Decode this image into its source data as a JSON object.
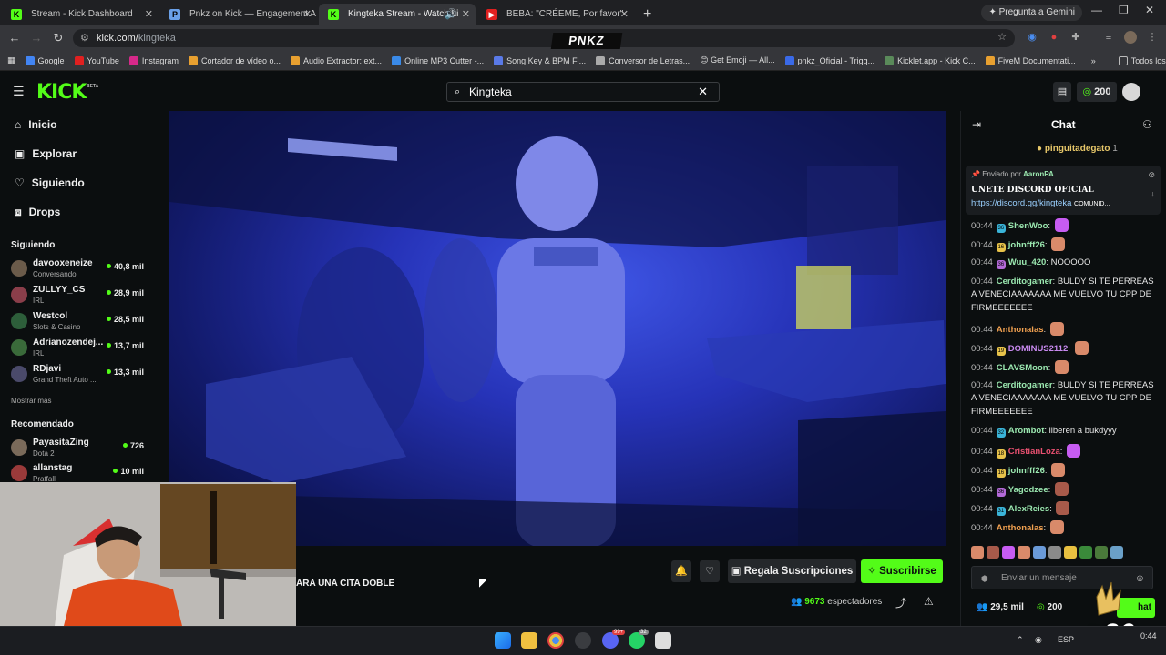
{
  "browser": {
    "tabs": [
      {
        "title": "Stream - Kick Dashboard",
        "icon": "kick-icon"
      },
      {
        "title": "Pnkz on Kick — Engagement A",
        "icon": "page-icon"
      },
      {
        "title": "Kingteka Stream - Watch Li",
        "icon": "kick-icon",
        "active": true
      },
      {
        "title": "BEBA: \"CRÉEME, Por favor\"",
        "icon": "youtube-icon"
      }
    ],
    "gemini_label": "Pregunta a Gemini",
    "url_host": "kick.com/",
    "url_path": "kingteka",
    "ext_badge": "PNKZ",
    "bookmarks": [
      "Google",
      "YouTube",
      "Instagram",
      "Cortador de vídeo o...",
      "Audio Extractor: ext...",
      "Online MP3 Cutter -...",
      "Song Key & BPM Fi...",
      "Conversor de Letras...",
      "😊 Get Emoji — All...",
      "pnkz_Oficial - Trigg...",
      "Kicklet.app - Kick C...",
      "FiveM Documentati..."
    ],
    "bookmarks_more": "»",
    "all_bookmarks": "Todos los marcadores"
  },
  "header": {
    "logo": "KICK",
    "beta": "BETA",
    "search_value": "Kingteka",
    "points": "200"
  },
  "sidebar": {
    "nav": [
      {
        "label": "Inicio",
        "icon": "home-icon"
      },
      {
        "label": "Explorar",
        "icon": "compass-icon"
      },
      {
        "label": "Siguiendo",
        "icon": "heart-icon"
      },
      {
        "label": "Drops",
        "icon": "drops-icon"
      }
    ],
    "following_title": "Siguiendo",
    "following": [
      {
        "name": "davooxeneize",
        "sub": "Conversando",
        "viewers": "40,8 mil",
        "color": "#6b5b4a"
      },
      {
        "name": "ZULLYY_CS",
        "sub": "IRL",
        "viewers": "28,9 mil",
        "color": "#8a3e4a"
      },
      {
        "name": "Westcol",
        "sub": "Slots & Casino",
        "viewers": "28,5 mil",
        "color": "#2d5e3a"
      },
      {
        "name": "Adrianozendej...",
        "sub": "IRL",
        "viewers": "13,7 mil",
        "color": "#3a6a3a"
      },
      {
        "name": "RDjavi",
        "sub": "Grand Theft Auto ...",
        "viewers": "13,3 mil",
        "color": "#4a4a6a"
      }
    ],
    "show_more": "Mostrar más",
    "recommended_title": "Recomendado",
    "recommended": [
      {
        "name": "PayasitaZing",
        "sub": "Dota 2",
        "viewers": "726",
        "color": "#7a6a5a"
      },
      {
        "name": "allanstag",
        "sub": "Pratfall",
        "viewers": "10 mil",
        "color": "#9a3a3a"
      }
    ]
  },
  "stream": {
    "caption": "ARA UNA CITA DOBLE",
    "gift_label": "Regala Suscripciones",
    "subscribe_label": "Suscribirse",
    "viewer_count": "9673",
    "viewer_label": "espectadores"
  },
  "chat": {
    "title": "Chat",
    "pinned_user": "pinguitadegato",
    "pinned_count": "1",
    "pinned_by_prefix": "Enviado por",
    "pinned_by": "AaronPA",
    "pinned_text": "UNETE DISCORD OFICIAL",
    "pinned_link": "https://discord.gg/kingteka",
    "pinned_tail": "COMUNID...",
    "messages": [
      {
        "time": "00:44",
        "badge": "36",
        "badge_color": "#3ab4d8",
        "user": "ShenWoo",
        "user_color": "#9be8b0",
        "text": "",
        "emote": "#c75cf2"
      },
      {
        "time": "00:44",
        "badge": "16",
        "badge_color": "#e8c34a",
        "user": "johnfff26",
        "user_color": "#9be8b0",
        "text": "",
        "emote": "#d98a6a"
      },
      {
        "time": "00:44",
        "badge": "36",
        "badge_color": "#b46ad8",
        "user": "Wuu_420",
        "user_color": "#9be8b0",
        "text": "NOOOOO",
        "emote": ""
      },
      {
        "time": "00:44",
        "badge": "",
        "badge_color": "",
        "user": "Cerditogamer",
        "user_color": "#9be8b0",
        "text": "BULDY SI TE PERREAS A VENECIAAAAAAA ME VUELVO TU CPP DE FIRMEEEEEEE",
        "emote": ""
      },
      {
        "time": "00:44",
        "badge": "",
        "badge_color": "",
        "user": "Anthonalas",
        "user_color": "#f0a050",
        "text": "",
        "emote": "#d98a6a"
      },
      {
        "time": "00:44",
        "badge": "19",
        "badge_color": "#e8c34a",
        "user": "DOMINUS2112",
        "user_color": "#c98af0",
        "text": "",
        "emote": "#d98a6a"
      },
      {
        "time": "00:44",
        "badge": "",
        "badge_color": "",
        "user": "CLAVSMoon",
        "user_color": "#9be8b0",
        "text": "",
        "emote": "#d98a6a"
      },
      {
        "time": "00:44",
        "badge": "",
        "badge_color": "",
        "user": "Cerditogamer",
        "user_color": "#9be8b0",
        "text": "BULDY SI TE PERREAS A VENECIAAAAAAA ME VUELVO TU CPP DE FIRMEEEEEEE",
        "emote": ""
      },
      {
        "time": "00:44",
        "badge": "32",
        "badge_color": "#3ab4d8",
        "user": "Arombot",
        "user_color": "#9be8b0",
        "text": "liberen a bukdyyy",
        "emote": ""
      },
      {
        "time": "00:44",
        "badge": "18",
        "badge_color": "#e8c34a",
        "user": "CristianLoza",
        "user_color": "#e85070",
        "text": "",
        "emote": "#c75cf2"
      },
      {
        "time": "00:44",
        "badge": "16",
        "badge_color": "#e8c34a",
        "user": "johnfff26",
        "user_color": "#9be8b0",
        "text": "",
        "emote": "#d98a6a"
      },
      {
        "time": "00:44",
        "badge": "36",
        "badge_color": "#b46ad8",
        "user": "Yagodzee",
        "user_color": "#9be8b0",
        "text": "",
        "emote": "#a85a4a"
      },
      {
        "time": "00:44",
        "badge": "31",
        "badge_color": "#3ab4d8",
        "user": "AlexReies",
        "user_color": "#9be8b0",
        "text": "",
        "emote": "#a85a4a"
      },
      {
        "time": "00:44",
        "badge": "",
        "badge_color": "",
        "user": "Anthonalas",
        "user_color": "#f0a050",
        "text": "",
        "emote": "#d98a6a"
      }
    ],
    "input_placeholder": "Enviar un mensaje",
    "followers": "29,5 mil",
    "points": "200",
    "chat_button_tail": "hat"
  },
  "overlay": {
    "multiplier": "x36"
  },
  "taskbar": {
    "lang": "ESP",
    "time": "0:44",
    "badge_discord": "99+",
    "badge_whatsapp": "32"
  },
  "colors": {
    "kick_green": "#53fc18",
    "bg": "#0b0e0f"
  }
}
